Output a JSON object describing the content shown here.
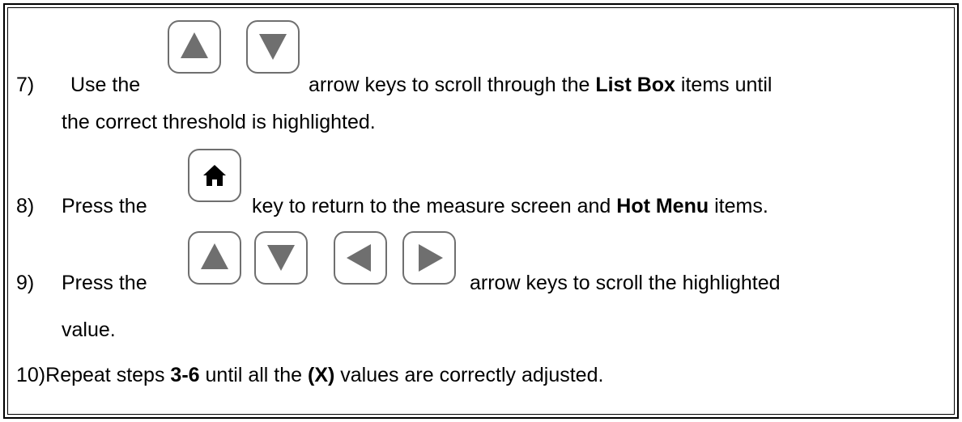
{
  "steps": [
    {
      "number": "7)",
      "lead": "Use the",
      "after_keys": "arrow keys to scroll through the",
      "bold1": "List Box",
      "tail": "items until",
      "continuation": "the correct threshold is highlighted.",
      "keys": [
        "up-arrow",
        "down-arrow"
      ]
    },
    {
      "number": "8)",
      "lead": "Press the",
      "after_keys": "key to return to the measure screen and",
      "bold1": "Hot Menu",
      "tail": "items.",
      "keys": [
        "home"
      ]
    },
    {
      "number": "9)",
      "lead": "Press the",
      "after_keys": "arrow keys to scroll the highlighted",
      "continuation": "value.",
      "keys": [
        "up-arrow",
        "down-arrow",
        "left-arrow",
        "right-arrow"
      ]
    },
    {
      "number": "10)",
      "pre": "Repeat steps",
      "bold1": "3-6",
      "mid": "until all the",
      "bold2": "(X)",
      "tail": "values are correctly adjusted."
    }
  ],
  "colors": {
    "key_border": "#6f6f6f",
    "key_glyph": "#6f6f6f",
    "text": "#000000"
  }
}
